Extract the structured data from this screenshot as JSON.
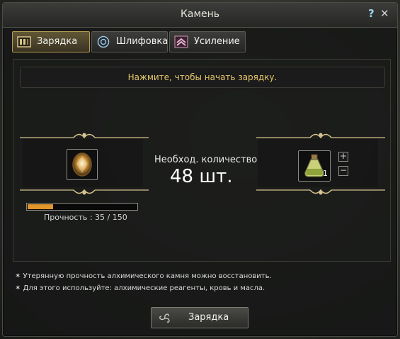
{
  "window": {
    "title": "Камень",
    "help_glyph": "?",
    "close_glyph": "✕"
  },
  "tabs": [
    {
      "label": "Зарядка",
      "icon": "charge-icon",
      "active": true
    },
    {
      "label": "Шлифовка",
      "icon": "polish-icon",
      "active": false
    },
    {
      "label": "Усиление",
      "icon": "enhance-icon",
      "active": false
    }
  ],
  "hint": "Нажмите, чтобы начать зарядку.",
  "stone": {
    "icon": "alchemy-stone-icon",
    "durability_label": "Прочность : 35 / 150",
    "durability_fraction": 0.2333
  },
  "requirement": {
    "label": "Необход. количество",
    "value": "48 шт."
  },
  "material": {
    "icon": "reagent-flask-icon",
    "quantity": "1",
    "plus": "+",
    "minus": "−"
  },
  "notes": [
    "✶ Утерянную прочность алхимического камня можно восстановить.",
    "✶ Для этого используйте: алхимические реагенты, кровь и масла."
  ],
  "action_button": {
    "label": "Зарядка",
    "icon": "triskelion-icon"
  },
  "colors": {
    "accent": "#e8c66b",
    "durability": "#e1962c",
    "active_tab_border": "#b49a52"
  }
}
